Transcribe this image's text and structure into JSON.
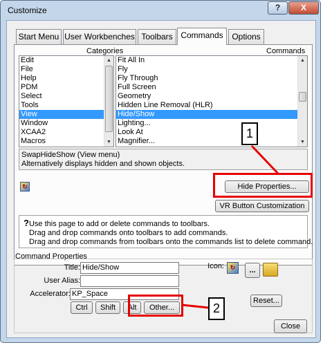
{
  "window": {
    "title": "Customize",
    "help_label": "?",
    "close_label": "X"
  },
  "tabs": [
    {
      "label": "Start Menu"
    },
    {
      "label": "User Workbenches"
    },
    {
      "label": "Toolbars"
    },
    {
      "label": "Commands",
      "active": true
    },
    {
      "label": "Options"
    }
  ],
  "lists": {
    "categories_header": "Categories",
    "commands_header": "Commands",
    "categories": [
      "Edit",
      "File",
      "Help",
      "PDM",
      "Select",
      "Tools",
      "View",
      "Window",
      "XCAA2",
      "Macros"
    ],
    "categories_selected": "View",
    "commands": [
      "Fit All In",
      "Fly",
      "Fly Through",
      "Full Screen",
      "Geometry",
      "Hidden Line Removal (HLR)",
      "Hide/Show",
      "Lighting...",
      "Look At",
      "Magnifier..."
    ],
    "commands_selected": "Hide/Show"
  },
  "description": {
    "line1": "SwapHideShow (View menu)",
    "line2": "Alternatively displays hidden and shown objects."
  },
  "buttons": {
    "hide_properties": "Hide Properties...",
    "vr_button": "VR Button Customization",
    "ctrl": "Ctrl",
    "shift": "Shift",
    "alt": "Alt",
    "other": "Other...",
    "reset": "Reset...",
    "more": "...",
    "close": "Close"
  },
  "help": {
    "mark": "?",
    "line1": "Use this page to add or delete commands to toolbars.",
    "line2": "Drag and drop commands onto toolbars to add commands.",
    "line3": "Drag and drop commands from toolbars onto the commands list to delete command."
  },
  "command_properties": {
    "group_label": "Command Properties",
    "title_label": "Title:",
    "title_value": "Hide/Show",
    "alias_label": "User Alias:",
    "alias_value": "",
    "accelerator_label": "Accelerator:",
    "accelerator_value": "KP_Space",
    "icon_label": "Icon:"
  },
  "annotations": {
    "callout1": "1",
    "callout2": "2"
  },
  "colors": {
    "selection": "#3399ff",
    "highlight_box": "#e60000",
    "window_frame": "#c4d6ea"
  }
}
